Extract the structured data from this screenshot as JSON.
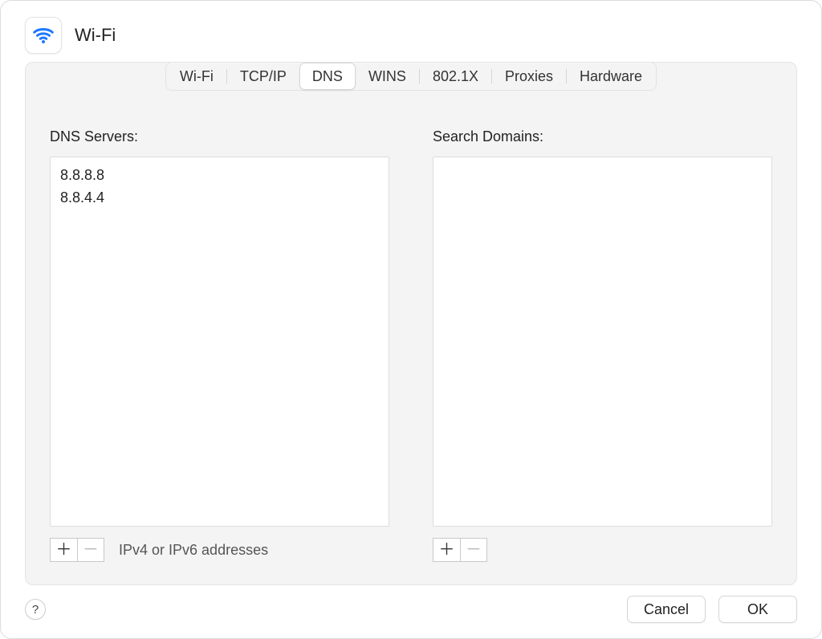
{
  "header": {
    "title": "Wi-Fi",
    "icon": "wifi-icon"
  },
  "tabs": {
    "items": [
      {
        "label": "Wi-Fi",
        "active": false
      },
      {
        "label": "TCP/IP",
        "active": false
      },
      {
        "label": "DNS",
        "active": true
      },
      {
        "label": "WINS",
        "active": false
      },
      {
        "label": "802.1X",
        "active": false
      },
      {
        "label": "Proxies",
        "active": false
      },
      {
        "label": "Hardware",
        "active": false
      }
    ]
  },
  "dns": {
    "servers_label": "DNS Servers:",
    "servers": [
      "8.8.8.8",
      "8.8.4.4"
    ],
    "hint": "IPv4 or IPv6 addresses",
    "domains_label": "Search Domains:",
    "domains": []
  },
  "buttons": {
    "cancel": "Cancel",
    "ok": "OK",
    "help": "?"
  },
  "glyphs": {
    "plus": "＋",
    "minus": "－"
  }
}
